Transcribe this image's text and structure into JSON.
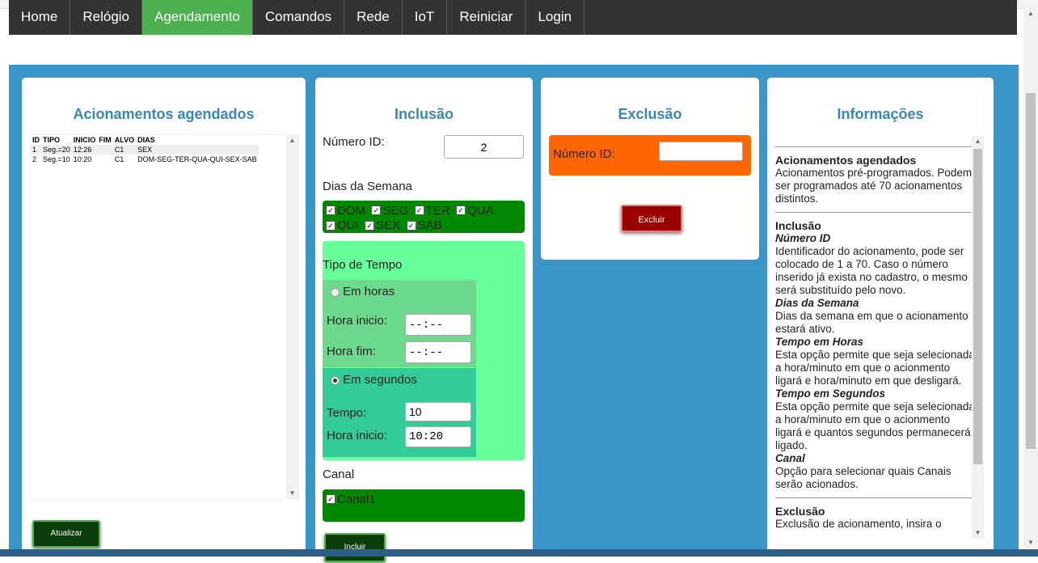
{
  "nav": {
    "items": [
      {
        "label": "Home",
        "active": false
      },
      {
        "label": "Relógio",
        "active": false
      },
      {
        "label": "Agendamento",
        "active": true
      },
      {
        "label": "Comandos",
        "active": false
      },
      {
        "label": "Rede",
        "active": false
      },
      {
        "label": "IoT",
        "active": false
      },
      {
        "label": "Reiniciar",
        "active": false
      },
      {
        "label": "Login",
        "active": false
      }
    ]
  },
  "schedules": {
    "title": "Acionamentos agendados",
    "columns": [
      "ID",
      "TIPO",
      "INICIO",
      "FIM",
      "ALVO",
      "DIAS"
    ],
    "rows": [
      [
        "1",
        "Seg.=20",
        "12:26",
        "",
        "C1",
        "SEX"
      ],
      [
        "2",
        "Seg.=10",
        "10:20",
        "",
        "C1",
        "DOM-SEG-TER-QUA-QUI-SEX-SAB"
      ]
    ],
    "refresh_label": "Atualizar"
  },
  "inclusion": {
    "title": "Inclusão",
    "id_label": "Número ID:",
    "id_value": "2",
    "days_label": "Dias da Semana",
    "days": [
      "DOM",
      "SEG",
      "TER",
      "QUA",
      "QUI",
      "SEX",
      "SAB"
    ],
    "time_type_label": "Tipo de Tempo",
    "hours_option": "Em horas",
    "start_hour_label": "Hora inicio:",
    "start_hour_value": "--:--",
    "end_hour_label": "Hora fim:",
    "end_hour_value": "--:--",
    "seconds_option": "Em segundos",
    "time_label": "Tempo:",
    "time_value": "10",
    "seconds_start_label": "Hora inicio:",
    "seconds_start_value": "10:20",
    "channel_label": "Canal",
    "channel_option": "Canal1",
    "submit_label": "Incluir"
  },
  "exclusion": {
    "title": "Exclusão",
    "id_label": "Número ID:",
    "id_value": "",
    "button_label": "Excluir"
  },
  "info": {
    "title": "Informações",
    "sections": [
      {
        "heading": "Acionamentos agendados",
        "text": "Acionamentos pré-programados. Podem ser programados até 70 acionamentos distintos."
      },
      {
        "heading": "Inclusão"
      },
      {
        "sub": "Número ID",
        "text": "Identificador do acionamento, pode ser colocado de 1 a 70. Caso o número inserido já exista no cadastro, o mesmo será substituído pelo novo."
      },
      {
        "sub": "Dias da Semana",
        "text": "Dias da semana em que o acionamento estará ativo."
      },
      {
        "sub": "Tempo em Horas",
        "text": "Esta opção permite que seja selecionada a hora/minuto em que o acionmento ligará e hora/minuto em que desligará."
      },
      {
        "sub": "Tempo em Segundos",
        "text": "Esta opção permite que seja selecionada a hora/minuto em que o acionmento ligará e quantos segundos permanecerá ligado."
      },
      {
        "sub": "Canal",
        "text": "Opção para selecionar quais Canais serão acionados."
      },
      {
        "heading": "Exclusão",
        "text": "Exclusão de acionamento, insira o"
      }
    ]
  },
  "colors": {
    "nav_bg": "#333333",
    "nav_active": "#4caf50",
    "main_bg": "#3a96c9",
    "title_color": "#3a86b8",
    "days_bg": "#008800",
    "inclusion_bg": "#66ff99",
    "hours_bg": "#6cd98c",
    "seconds_bg": "#33cc99",
    "exclusion_box": "#ff6600",
    "delete_button": "#990000"
  }
}
